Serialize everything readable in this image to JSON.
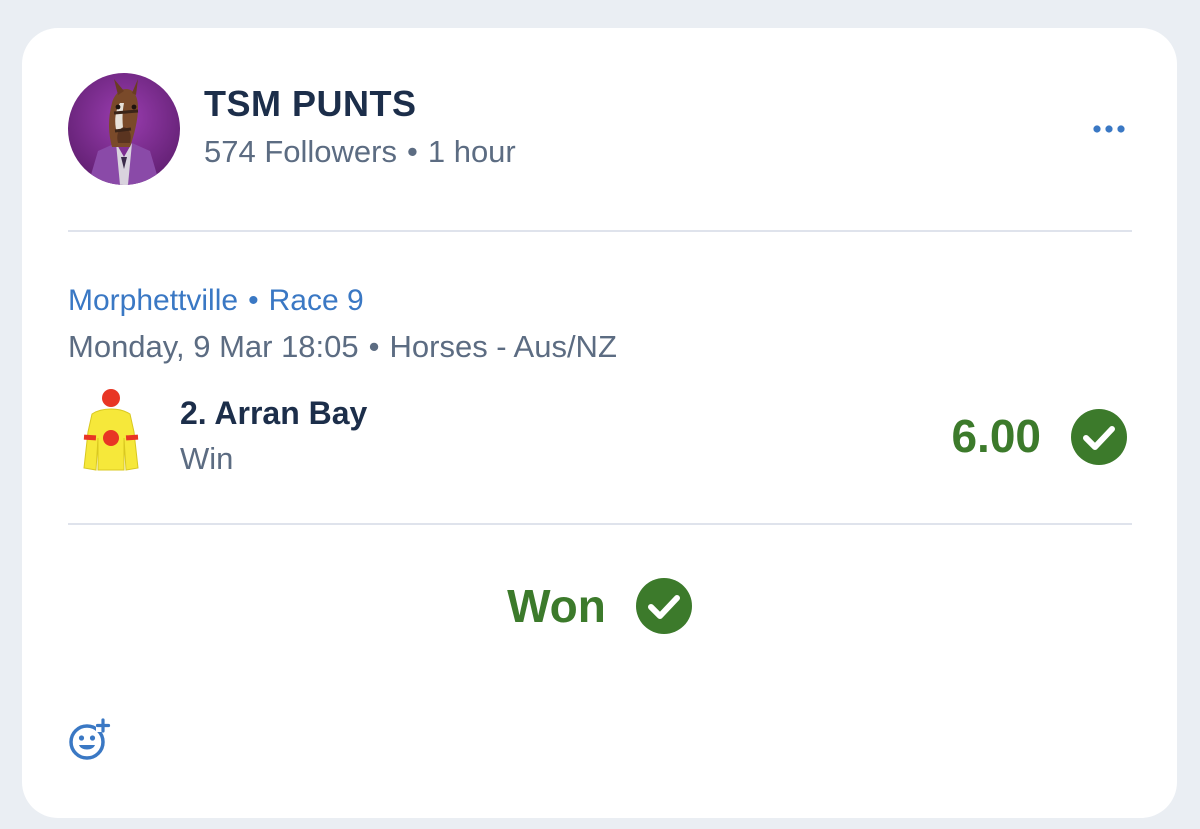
{
  "author": {
    "name": "TSM PUNTS",
    "followers": "574 Followers",
    "time": "1 hour",
    "separator": "•"
  },
  "event": {
    "venue": "Morphettville",
    "race": "Race 9",
    "datetime": "Monday, 9 Mar 18:05",
    "category": "Horses - Aus/NZ",
    "separator": "•"
  },
  "selection": {
    "runner": "2. Arran Bay",
    "bet_type": "Win",
    "odds": "6.00",
    "silks_colors": {
      "body": "#f6e83a",
      "spots": "#e83524",
      "cap": "#e83524"
    }
  },
  "result": {
    "label": "Won"
  },
  "icons": {
    "more": "more-horizontal-icon",
    "check": "check-circle-icon",
    "react": "add-reaction-icon"
  },
  "colors": {
    "accent_blue": "#3a78c4",
    "win_green": "#3c7a2b",
    "text_dark": "#1c2e4a",
    "text_muted": "#5c6c82",
    "avatar_bg": "#7b2c8c"
  }
}
